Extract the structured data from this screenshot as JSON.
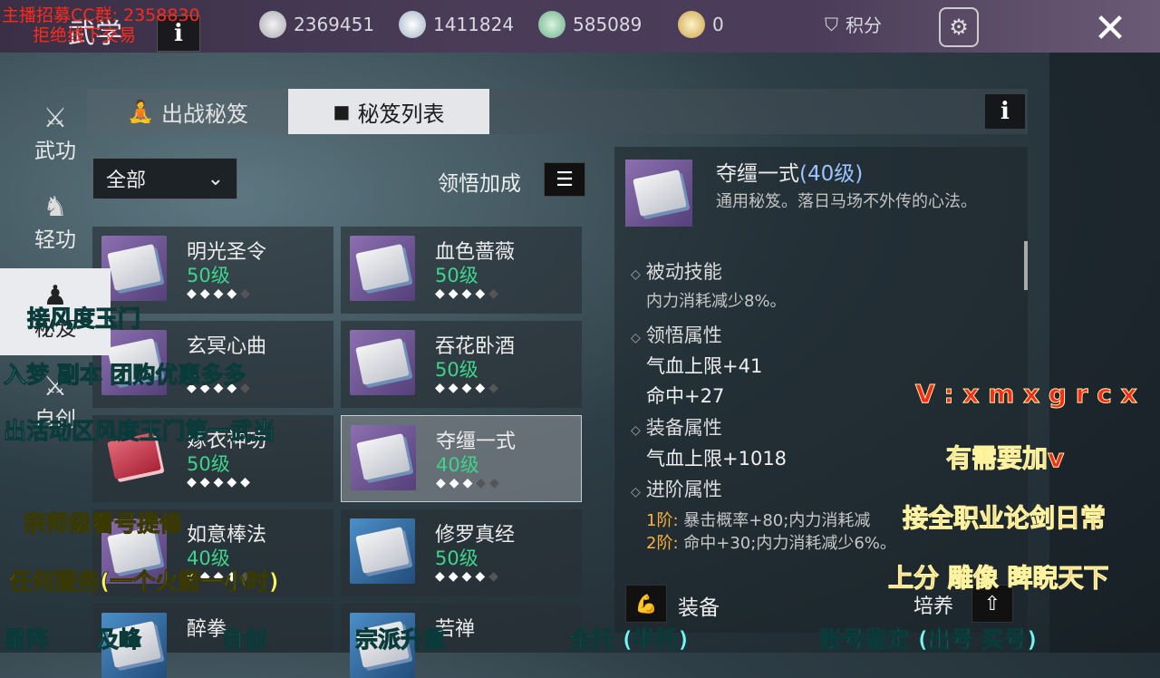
{
  "header": {
    "title": "武学",
    "resources": [
      {
        "icon": "silver-coin-icon",
        "value": "2369451"
      },
      {
        "icon": "bowl-icon",
        "value": "1411824"
      },
      {
        "icon": "jade-icon",
        "value": "585089"
      },
      {
        "icon": "gold-bowl-icon",
        "value": "0"
      }
    ],
    "points_label": "积分"
  },
  "tabs": {
    "battle": "出战秘笈",
    "list": "秘笈列表"
  },
  "filter": {
    "selected": "全部",
    "bonus_label": "领悟加成"
  },
  "cards": [
    {
      "name": "明光圣令",
      "level": "50级",
      "stars_on": 4,
      "stars_off": 1,
      "thumb": "purple",
      "book": "white"
    },
    {
      "name": "血色蔷薇",
      "level": "50级",
      "stars_on": 4,
      "stars_off": 1,
      "thumb": "purple",
      "book": "white"
    },
    {
      "name": "玄冥心曲",
      "level": "",
      "stars_on": 4,
      "stars_off": 1,
      "thumb": "purple",
      "book": "white"
    },
    {
      "name": "吞花卧酒",
      "level": "50级",
      "stars_on": 4,
      "stars_off": 1,
      "thumb": "purple",
      "book": "white"
    },
    {
      "name": "嫁衣神功",
      "level": "50级",
      "stars_on": 5,
      "stars_off": 0,
      "thumb": "none",
      "book": "red"
    },
    {
      "name": "夺缰一式",
      "level": "40级",
      "stars_on": 3,
      "stars_off": 2,
      "thumb": "purple",
      "book": "white",
      "selected": true
    },
    {
      "name": "如意棒法",
      "level": "40级",
      "stars_on": 4,
      "stars_off": 1,
      "thumb": "purple",
      "book": "white"
    },
    {
      "name": "修罗真经",
      "level": "50级",
      "stars_on": 4,
      "stars_off": 1,
      "thumb": "blue",
      "book": "white"
    },
    {
      "name": "醉拳",
      "level": "",
      "stars_on": 0,
      "stars_off": 0,
      "thumb": "blue",
      "book": "white"
    },
    {
      "name": "若禅",
      "level": "",
      "stars_on": 0,
      "stars_off": 0,
      "thumb": "blue",
      "book": "white"
    }
  ],
  "detail": {
    "name": "夺缰一式",
    "level": "(40级)",
    "desc": "通用秘笈。落日马场不外传的心法。",
    "passive_h": "被动技能",
    "passive": "内力消耗减少8%。",
    "comprehend_h": "领悟属性",
    "comprehend": [
      "气血上限+41",
      "命中+27"
    ],
    "equip_h": "装备属性",
    "equip_attr": "气血上限+1018",
    "adv_h": "进阶属性",
    "adv": [
      {
        "stage": "1阶:",
        "text": "暴击概率+80;内力消耗减"
      },
      {
        "stage": "2阶:",
        "text": "命中+30;内力消耗减少6%。"
      }
    ],
    "equip_btn": "装备",
    "train_btn": "培养"
  },
  "rnav": [
    {
      "label": "武功",
      "icon": "martial-icon"
    },
    {
      "label": "轻功",
      "icon": "lightness-icon"
    },
    {
      "label": "秘笈",
      "icon": "meditation-icon",
      "active": true
    },
    {
      "label": "自创",
      "icon": "sword-icon"
    }
  ],
  "overlay": {
    "streamer": "主播招募CC群: 2358830",
    "refuse": "拒绝线下交易",
    "l1": "接风度玉门",
    "l2": "入梦  副本  团购优惠多多",
    "l3": "出活动区风度玉门第一武当",
    "l4": "宗师级看号提修",
    "l5": "任何服务(一个火箭一小时)",
    "vx": "V : x m x g r c x",
    "need": "有需要加v",
    "all": "接全职业论剑日常",
    "up": "上分  雕像  睥睨天下",
    "bottom": [
      "星阵",
      "及峰",
      "自创",
      "宗派升重",
      "全托 (半托)",
      "账号鉴定 (出号  买号)"
    ]
  }
}
